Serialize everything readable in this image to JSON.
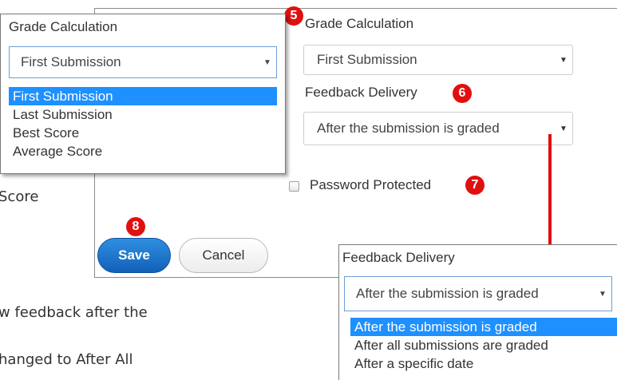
{
  "background_text": {
    "score_fragment": "Score",
    "line1_fragment": "w feedback after the",
    "line2_fragment": "hanged to After All"
  },
  "form": {
    "grade_calculation_label": "Grade Calculation",
    "grade_calculation_value": "First Submission",
    "feedback_delivery_label": "Feedback Delivery",
    "feedback_delivery_value": "After the submission is graded",
    "password_protected_label": "Password Protected",
    "save_label": "Save",
    "cancel_label": "Cancel"
  },
  "badges": {
    "b5": "5",
    "b6": "6",
    "b7": "7",
    "b8": "8"
  },
  "grade_popup": {
    "title": "Grade Calculation",
    "current_value": "First Submission",
    "options": [
      "First Submission",
      "Last Submission",
      "Best Score",
      "Average Score"
    ],
    "selected_index": 0
  },
  "feedback_popup": {
    "title": "Feedback Delivery",
    "current_value": "After the submission is graded",
    "options": [
      "After the submission is graded",
      "After all submissions are graded",
      "After a specific date"
    ],
    "selected_index": 0
  },
  "colors": {
    "badge": "#e01010",
    "highlight": "#1e90ff",
    "save_button": "#1a6fcc"
  },
  "icons": {
    "dropdown": "chevron-down-icon",
    "checkbox": "checkbox-icon",
    "annotation_arrow": "arrow-down-icon"
  }
}
